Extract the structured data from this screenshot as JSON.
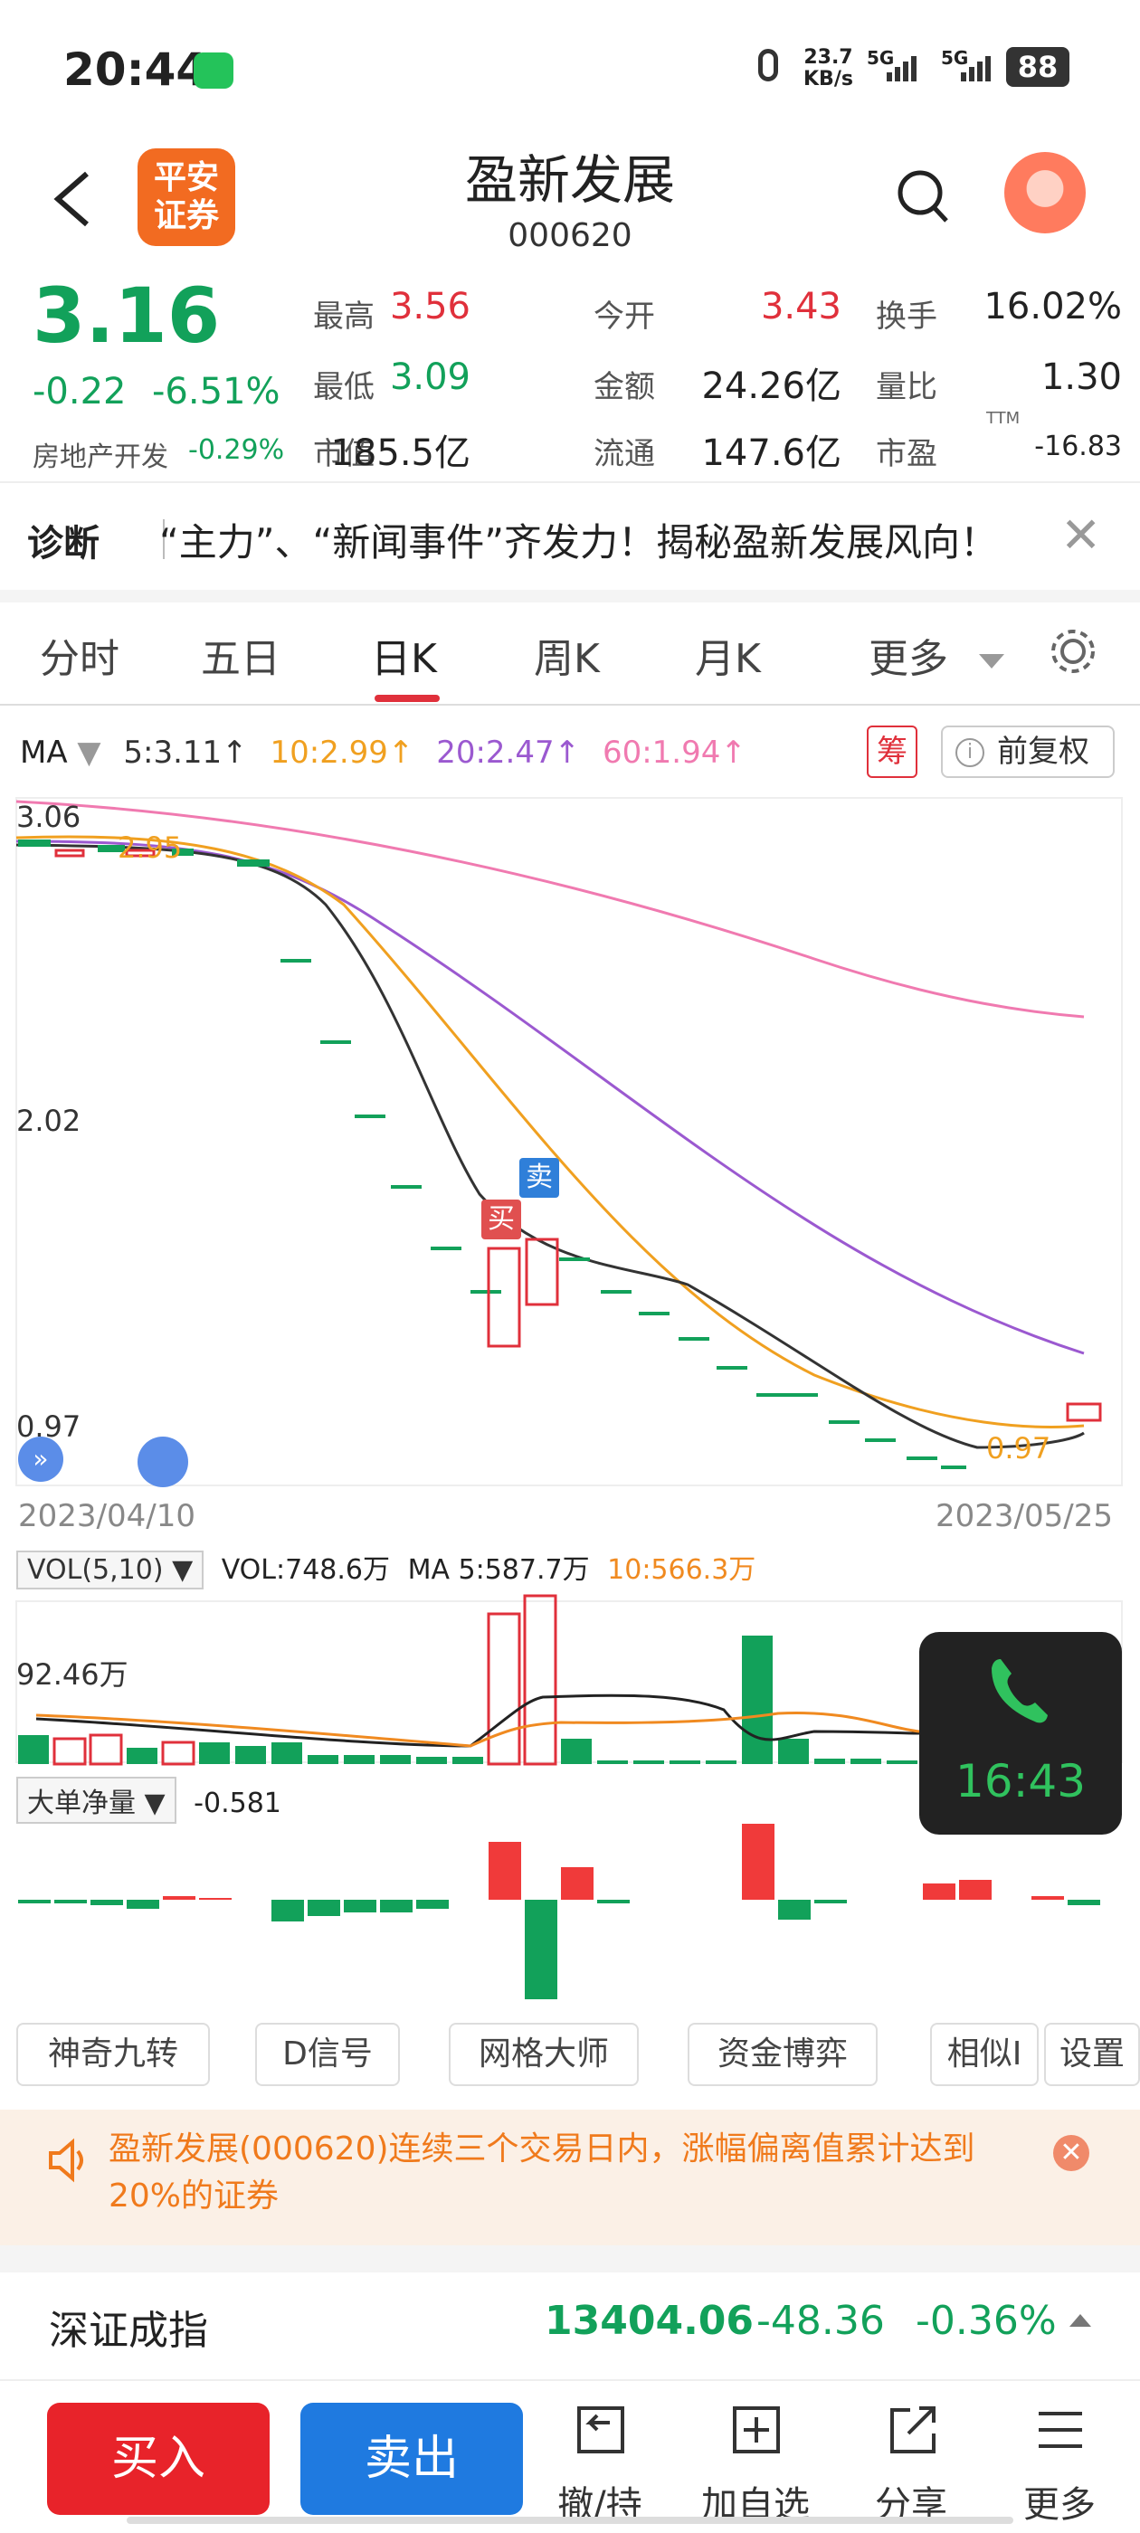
{
  "status_bar": {
    "time": "20:44",
    "net_speed_value": "23.7",
    "net_speed_unit": "KB/s",
    "sim1": "5G",
    "sim2": "5G",
    "battery": "88"
  },
  "header": {
    "logo_line1": "平安",
    "logo_line2": "证券",
    "stock_name": "盈新发展",
    "stock_code": "000620"
  },
  "quote": {
    "price": "3.16",
    "change": "-0.22",
    "change_pct": "-6.51%",
    "sector": "房地产开发",
    "sector_change": "-0.29%",
    "stats": [
      {
        "label": "最高",
        "value": "3.56",
        "color": "#e0303b"
      },
      {
        "label": "今开",
        "value": "3.43",
        "color": "#e0303b"
      },
      {
        "label": "换手",
        "value": "16.02%",
        "color": "#222222"
      },
      {
        "label": "最低",
        "value": "3.09",
        "color": "#12a15a"
      },
      {
        "label": "金额",
        "value": "24.26亿",
        "color": "#222222"
      },
      {
        "label": "量比",
        "value": "1.30",
        "color": "#222222"
      },
      {
        "label": "市值",
        "value": "185.5亿",
        "color": "#222222"
      },
      {
        "label": "流通",
        "value": "147.6亿",
        "color": "#222222"
      },
      {
        "label": "市盈",
        "value": "-16.83",
        "color": "#222222"
      }
    ],
    "pe_superscript": "TTM"
  },
  "diagnosis": {
    "label": "诊断",
    "text": "“主力”、“新闻事件”齐发力！揭秘盈新发展风向！",
    "close": "✕"
  },
  "tabs": [
    "分时",
    "五日",
    "日K",
    "周K",
    "月K",
    "更多"
  ],
  "active_tab": "日K",
  "ma_legend": {
    "label": "MA",
    "items": [
      {
        "text": "5:3.11↑",
        "color": "#333333"
      },
      {
        "text": "10:2.99↑",
        "color": "#f0a020"
      },
      {
        "text": "20:2.47↑",
        "color": "#9b59d0"
      },
      {
        "text": "60:1.94↑",
        "color": "#f07ab0"
      }
    ],
    "chip_badge": "筹",
    "adjust_label": "前复权",
    "info": "i"
  },
  "kline": {
    "y_max_label": "3.06",
    "y_mid_label": "2.02",
    "y_min_label": "0.97",
    "high_marker": "2.95",
    "low_marker": "0.97",
    "buy_marker": "买",
    "sell_marker": "卖",
    "date_start": "2023/04/10",
    "date_end": "2023/05/25"
  },
  "volume": {
    "legend_chip": "VOL(5,10)",
    "vol_text": "VOL:748.6万",
    "ma5_text": "MA 5:587.7万",
    "ma10_text": "10:566.3万",
    "max_label": "92.46万"
  },
  "flow": {
    "legend_chip": "大单净量",
    "value": "-0.581"
  },
  "call": {
    "duration": "16:43"
  },
  "tools": [
    "神奇九转",
    "D信号",
    "网格大师",
    "资金博弈",
    "相似I",
    "设置"
  ],
  "notice": {
    "text": "盈新发展(000620)连续三个交易日内，涨幅偏离值累计达到20%的证券",
    "close": "✕"
  },
  "index": {
    "name": "深证成指",
    "value": "13404.06",
    "change": "-48.36",
    "change_pct": "-0.36%"
  },
  "bottom_bar": {
    "buy": "买入",
    "sell": "卖出",
    "items": [
      "撤/持",
      "加自选",
      "分享",
      "更多"
    ]
  },
  "colors": {
    "up": "#e0303b",
    "down": "#12a15a",
    "ma5": "#333333",
    "ma10": "#f0a020",
    "ma20": "#9b59d0",
    "ma60": "#f07ab0"
  }
}
